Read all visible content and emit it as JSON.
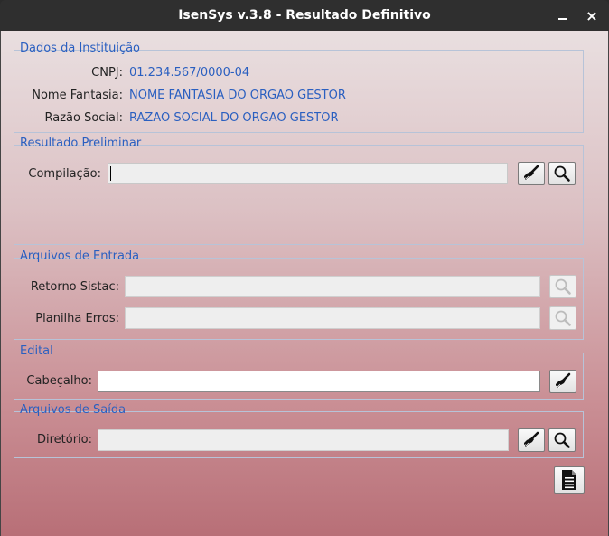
{
  "window": {
    "title": "IsenSys v.3.8 - Resultado Definitivo",
    "minimize_glyph": "minimize",
    "close_glyph": "×"
  },
  "dados_instituicao": {
    "title": "Dados da Instituição",
    "cnpj_label": "CNPJ:",
    "cnpj_value": "01.234.567/0000-04",
    "nome_fantasia_label": "Nome Fantasia:",
    "nome_fantasia_value": "NOME FANTASIA DO ORGAO GESTOR",
    "razao_social_label": "Razão Social:",
    "razao_social_value": "RAZAO SOCIAL DO ORGAO GESTOR"
  },
  "resultado_preliminar": {
    "title": "Resultado Preliminar",
    "compilacao_label": "Compilação:",
    "compilacao_value": ""
  },
  "arquivos_entrada": {
    "title": "Arquivos de Entrada",
    "retorno_sistac_label": "Retorno Sistac:",
    "retorno_sistac_value": "",
    "planilha_erros_label": "Planilha Erros:",
    "planilha_erros_value": ""
  },
  "edital": {
    "title": "Edital",
    "cabecalho_label": "Cabeçalho:",
    "cabecalho_value": ""
  },
  "arquivos_saida": {
    "title": "Arquivos de Saída",
    "diretorio_label": "Diretório:",
    "diretorio_value": ""
  },
  "icons": {
    "clear": "broom-icon",
    "search": "magnifier-icon",
    "generate": "document-icon"
  },
  "colors": {
    "accent_blue": "#2a5fc0",
    "titlebar": "#2f2f2f"
  }
}
